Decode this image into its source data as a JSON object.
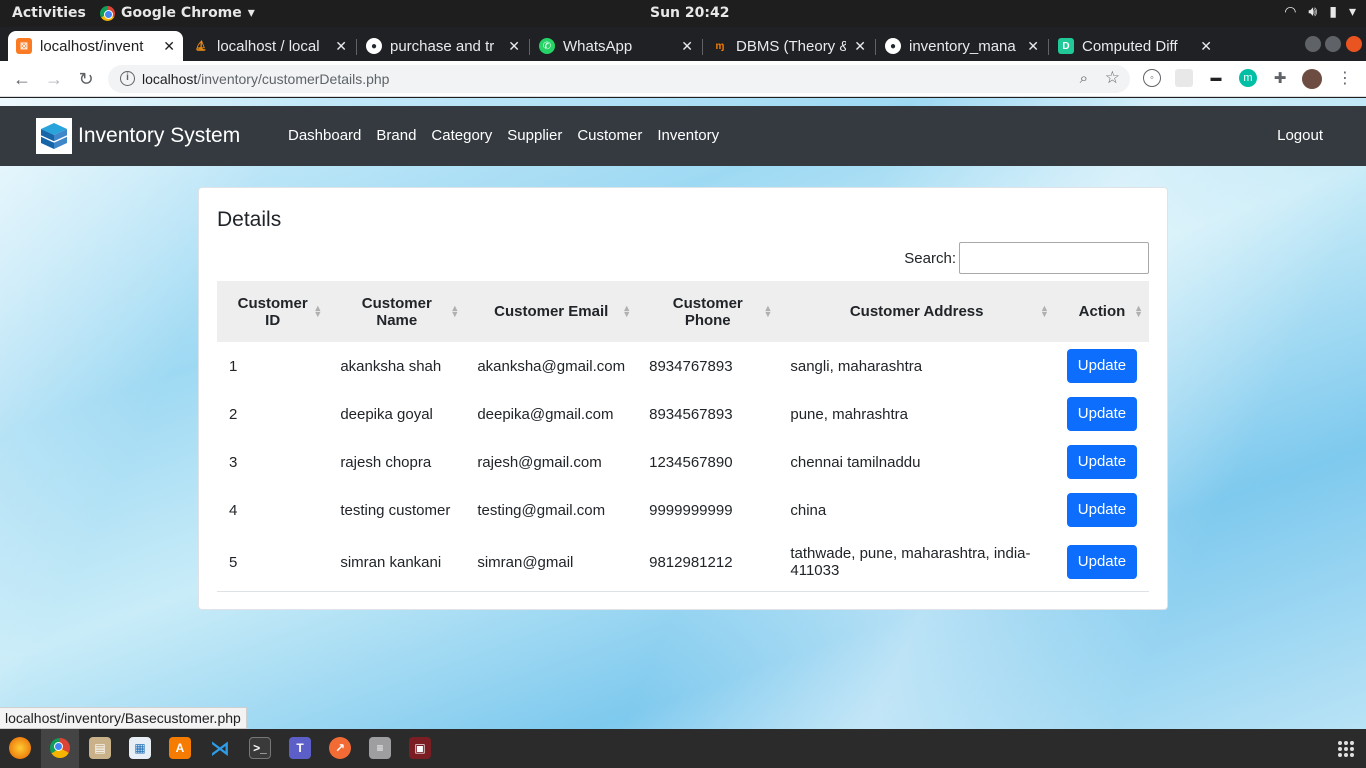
{
  "system": {
    "activities": "Activities",
    "app_name": "Google Chrome",
    "clock": "Sun 20:42"
  },
  "tabs": [
    {
      "title": "localhost/invent",
      "icon": "xampp-icon",
      "color": "#fb7a24"
    },
    {
      "title": "localhost / local",
      "icon": "phpmyadmin-icon",
      "color": "#f29111"
    },
    {
      "title": "purchase and tr",
      "icon": "github-icon",
      "color": "#24292e"
    },
    {
      "title": "WhatsApp",
      "icon": "whatsapp-icon",
      "color": "#25d366"
    },
    {
      "title": "DBMS (Theory &",
      "icon": "geeks-icon",
      "color": "#f57c00"
    },
    {
      "title": "inventory_mana",
      "icon": "github-icon",
      "color": "#24292e"
    },
    {
      "title": "Computed Diff",
      "icon": "diff-icon",
      "color": "#20c997"
    }
  ],
  "address": {
    "host": "localhost",
    "path": "/inventory/customerDetails.php"
  },
  "navbar": {
    "brand": "Inventory System",
    "links": [
      "Dashboard",
      "Brand",
      "Category",
      "Supplier",
      "Customer",
      "Inventory"
    ],
    "logout": "Logout"
  },
  "card": {
    "title": "Details",
    "search_label": "Search:"
  },
  "table": {
    "headers": [
      "Customer ID",
      "Customer Name",
      "Customer Email",
      "Customer Phone",
      "Customer Address",
      "Action"
    ],
    "rows": [
      {
        "id": "1",
        "name": "akanksha shah",
        "email": "akanksha@gmail.com",
        "phone": "8934767893",
        "address": "sangli, maharashtra",
        "action": "Update"
      },
      {
        "id": "2",
        "name": "deepika goyal",
        "email": "deepika@gmail.com",
        "phone": "8934567893",
        "address": "pune, mahrashtra",
        "action": "Update"
      },
      {
        "id": "3",
        "name": "rajesh chopra",
        "email": "rajesh@gmail.com",
        "phone": "1234567890",
        "address": "chennai tamilnaddu",
        "action": "Update"
      },
      {
        "id": "4",
        "name": "testing customer",
        "email": "testing@gmail.com",
        "phone": "9999999999",
        "address": "china",
        "action": "Update"
      },
      {
        "id": "5",
        "name": "simran kankani",
        "email": "simran@gmail",
        "phone": "9812981212",
        "address": "tathwade, pune, maharashtra, india-411033",
        "action": "Update"
      }
    ]
  },
  "status_url": "localhost/inventory/Basecustomer.php",
  "colors": {
    "navbar": "#343a40",
    "primary_button": "#0d6efd",
    "table_header": "#eeeeee"
  }
}
